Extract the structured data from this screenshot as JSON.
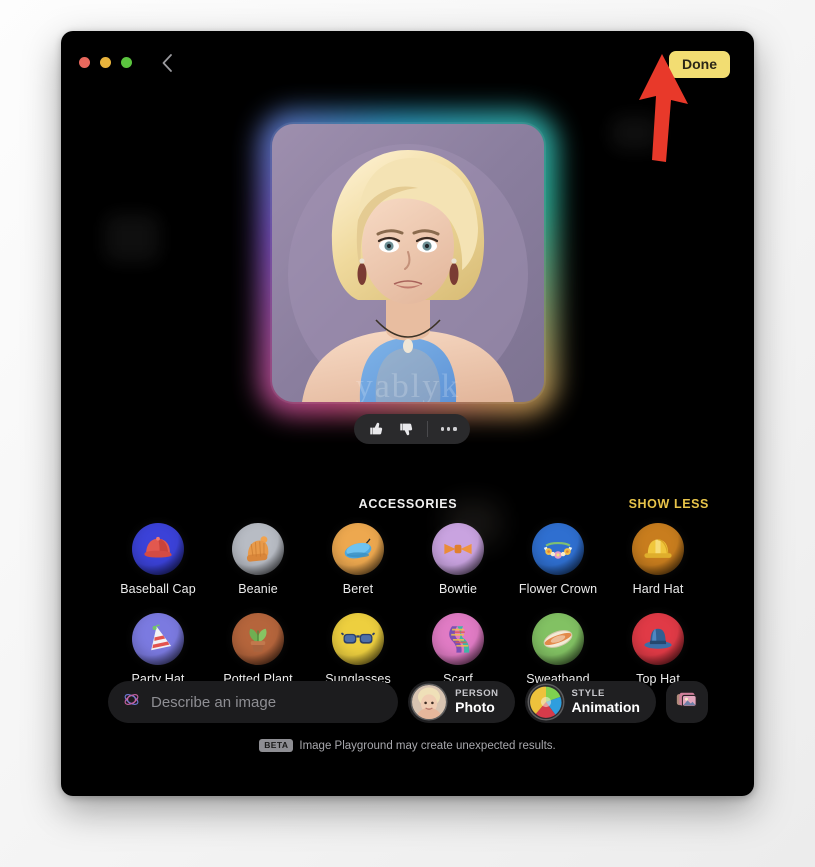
{
  "window": {
    "traffic_lights": [
      "close",
      "minimize",
      "zoom"
    ],
    "back_label": "Back",
    "done_label": "Done",
    "done_color": "#f2dd72"
  },
  "hero": {
    "alt": "Generated animation-style portrait of a blonde woman in a blue tank top",
    "watermark": "yablyk"
  },
  "feedback": {
    "thumbs_up": "Like",
    "thumbs_down": "Dislike",
    "more": "More options"
  },
  "accessories": {
    "title": "ACCESSORIES",
    "show_less": "SHOW LESS",
    "items": [
      {
        "label": "Baseball Cap",
        "bg": "#3b42d8",
        "icon": "baseball-cap-icon"
      },
      {
        "label": "Beanie",
        "bg": "#b8bcc4",
        "icon": "beanie-icon"
      },
      {
        "label": "Beret",
        "bg": "#eda84f",
        "icon": "beret-icon"
      },
      {
        "label": "Bowtie",
        "bg": "#c9a3e0",
        "icon": "bowtie-icon"
      },
      {
        "label": "Flower Crown",
        "bg": "#2f6fd0",
        "icon": "flower-crown-icon"
      },
      {
        "label": "Hard Hat",
        "bg": "#c87d1e",
        "icon": "hard-hat-icon"
      },
      {
        "label": "Party Hat",
        "bg": "#7b7ae0",
        "icon": "party-hat-icon"
      },
      {
        "label": "Potted Plant",
        "bg": "#b5653c",
        "icon": "potted-plant-icon"
      },
      {
        "label": "Sunglasses",
        "bg": "#edcf3f",
        "icon": "sunglasses-icon"
      },
      {
        "label": "Scarf",
        "bg": "#e07bc4",
        "icon": "scarf-icon"
      },
      {
        "label": "Sweatband",
        "bg": "#82c163",
        "icon": "sweatband-icon"
      },
      {
        "label": "Top Hat",
        "bg": "#e03a46",
        "icon": "top-hat-icon"
      }
    ]
  },
  "bottom_bar": {
    "describe": {
      "value": "",
      "placeholder": "Describe an image",
      "icon": "playground-icon"
    },
    "person_chip": {
      "kicker": "PERSON",
      "value": "Photo",
      "icon": "person-avatar"
    },
    "style_chip": {
      "kicker": "STYLE",
      "value": "Animation",
      "icon": "style-swatch-icon"
    },
    "photo_library_button": "photo-library-icon"
  },
  "footer": {
    "badge": "BETA",
    "text": "Image Playground may create unexpected results."
  },
  "annotation": {
    "arrow": "red-arrow-up",
    "color": "#e8392a"
  }
}
